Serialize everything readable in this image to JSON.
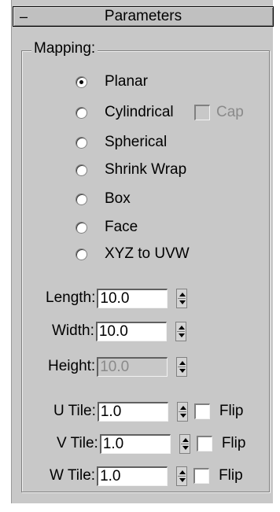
{
  "rollout": {
    "collapse_symbol": "–",
    "title": "Parameters"
  },
  "mapping": {
    "group_label": "Mapping:",
    "options": [
      {
        "label": "Planar",
        "selected": true
      },
      {
        "label": "Cylindrical",
        "selected": false
      },
      {
        "label": "Spherical",
        "selected": false
      },
      {
        "label": "Shrink Wrap",
        "selected": false
      },
      {
        "label": "Box",
        "selected": false
      },
      {
        "label": "Face",
        "selected": false
      },
      {
        "label": "XYZ to UVW",
        "selected": false
      }
    ],
    "cap": {
      "label": "Cap",
      "checked": false,
      "enabled": false
    }
  },
  "dimensions": {
    "length": {
      "label": "Length:",
      "value": "10.0"
    },
    "width": {
      "label": "Width:",
      "value": "10.0"
    },
    "height": {
      "label": "Height:",
      "value": "10.0",
      "enabled": false
    }
  },
  "tiling": {
    "u": {
      "label": "U Tile:",
      "value": "1.0",
      "flip_label": "Flip",
      "flip_checked": false
    },
    "v": {
      "label": "V Tile:",
      "value": "1.0",
      "flip_label": "Flip",
      "flip_checked": false
    },
    "w": {
      "label": "W Tile:",
      "value": "1.0",
      "flip_label": "Flip",
      "flip_checked": false
    }
  }
}
